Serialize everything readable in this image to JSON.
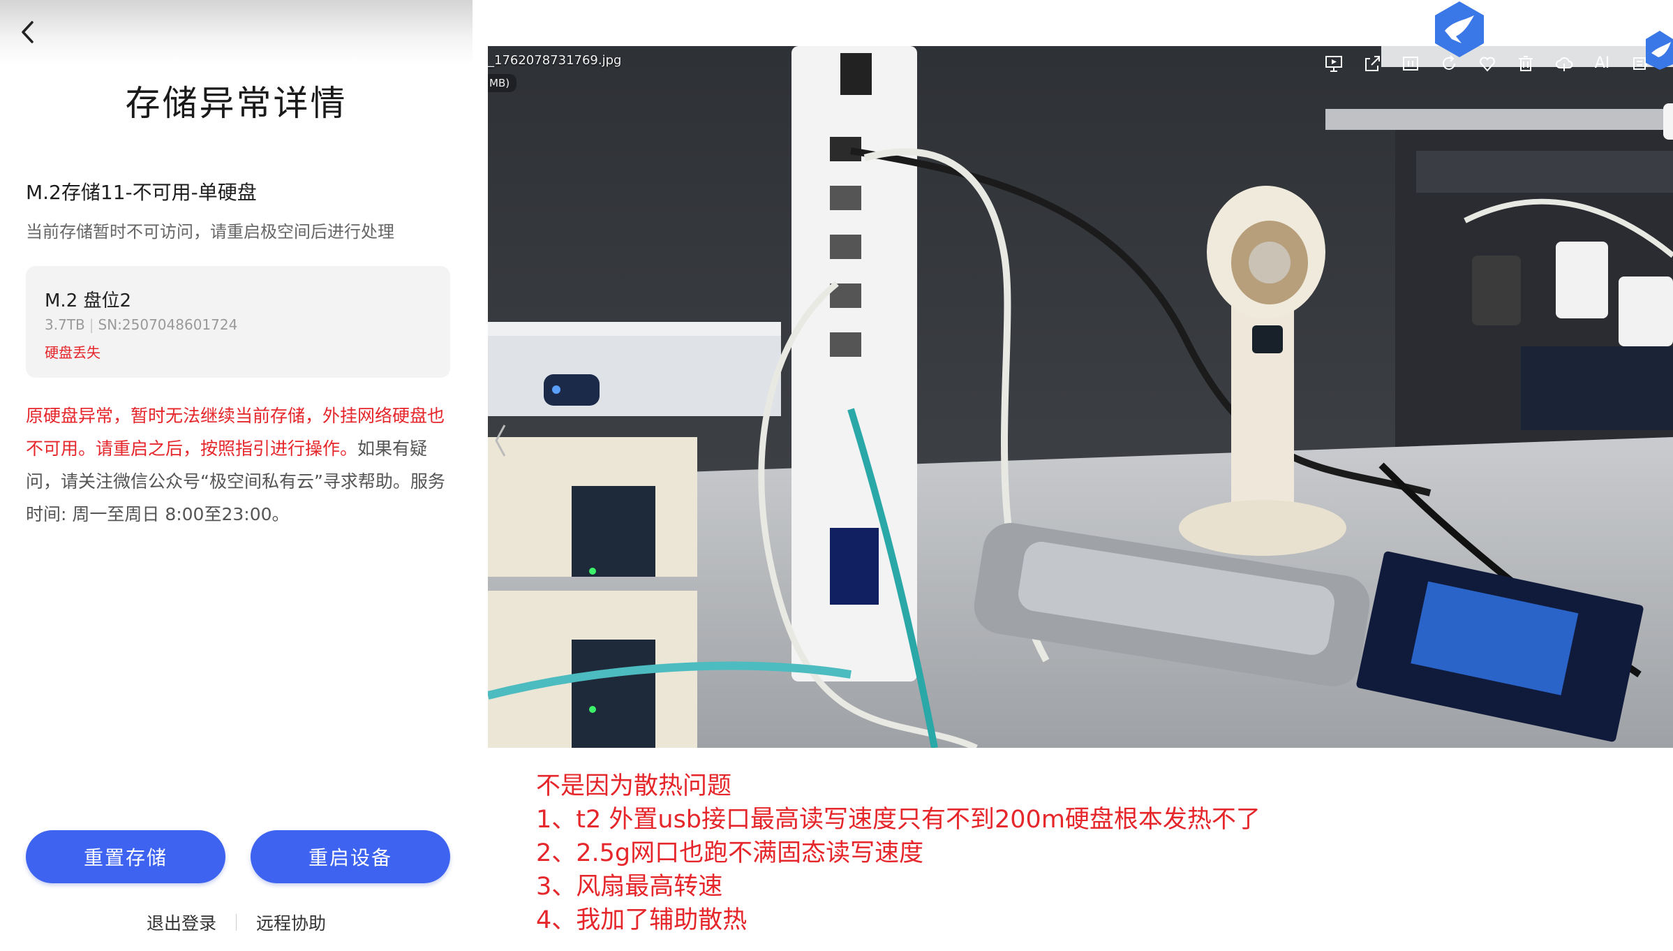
{
  "phone": {
    "title": "存储异常详情",
    "storage_name": "M.2存储11-不可用-单硬盘",
    "storage_desc": "当前存储暂时不可访问，请重启极空间后进行处理",
    "disk": {
      "slot": "M.2 盘位2",
      "capacity": "3.7TB",
      "serial": "SN:2507048601724",
      "status": "硬盘丢失"
    },
    "notice_red": "原硬盘异常，暂时无法继续当前存储，外挂网络硬盘也不可用。请重启之后，按照指引进行操作。",
    "notice_rest": "如果有疑问，请关注微信公众号“极空间私有云”寻求帮助。服务时间: 周一至周日 8:00至23:00。",
    "reset_button": "重置存储",
    "restart_button": "重启设备",
    "logout_link": "退出登录",
    "remote_link": "远程协助"
  },
  "viewer": {
    "filename": "_1762078731769.jpg",
    "filesize": "MB)",
    "toolbar_icons": [
      "slideshow-icon",
      "share-icon",
      "info-icon",
      "rotate-icon",
      "favorite-icon",
      "delete-icon",
      "cloud-icon",
      "ai-icon",
      "reader-icon"
    ],
    "ai_label": "AI"
  },
  "note": {
    "lines": [
      "不是因为散热问题",
      "1、t2 外置usb接口最高读写速度只有不到200m硬盘根本发热不了",
      "2、2.5g网口也跑不满固态读写速度",
      "3、风扇最高转速",
      "4、我加了辅助散热"
    ]
  },
  "colors": {
    "accent_blue": "#3e63f0",
    "alert_red": "#e5262b"
  }
}
